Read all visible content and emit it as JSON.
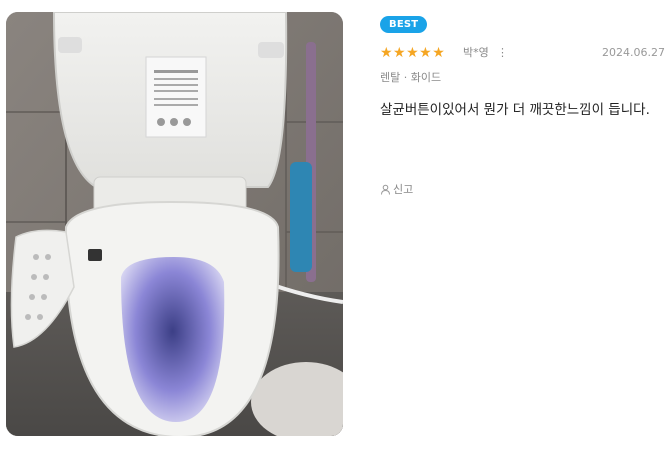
{
  "review": {
    "badge": "BEST",
    "rating": 5,
    "stars": "★★★★★",
    "user": "박*영",
    "more_icon": "⋮",
    "date": "2024.06.27",
    "option": "렌탈 · 화이드",
    "text": "살균버튼이있어서 뭔가 더 깨끗한느낌이 듭니다.",
    "report_label": "신고"
  },
  "photo": {
    "subject": "toilet-with-bidet-seat-photo"
  },
  "colors": {
    "badge": "#1aa3e8",
    "stars": "#f5a623"
  }
}
